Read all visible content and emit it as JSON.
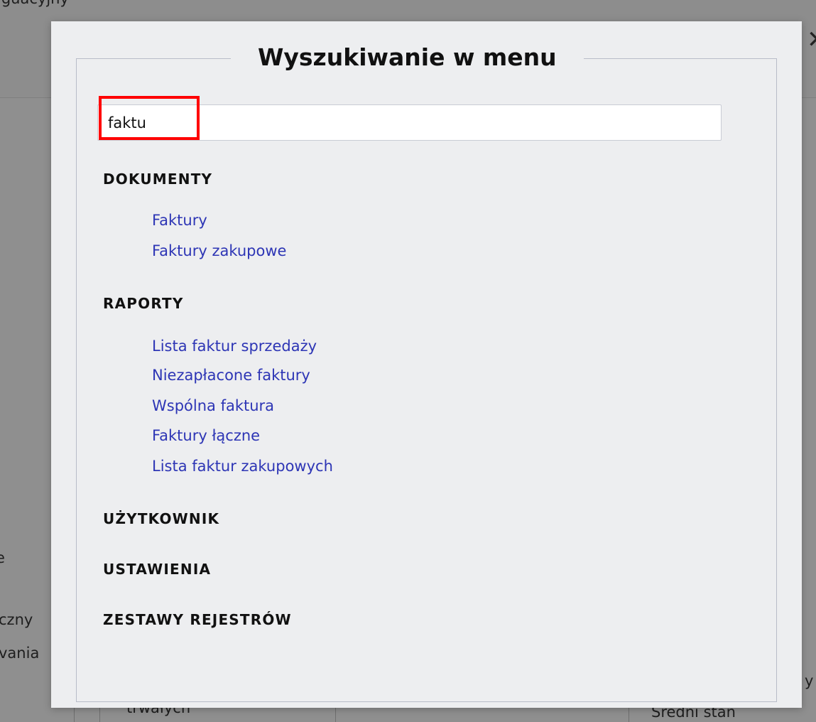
{
  "background": {
    "top_fragment": "iguacyjny",
    "left_fragments": [
      "e",
      "czny",
      "vania"
    ],
    "bottom_fragments": [
      "trwałych",
      "Średni stan"
    ],
    "right_fragment": "y"
  },
  "modal": {
    "title": "Wyszukiwanie w menu",
    "search": {
      "value": "faktu",
      "placeholder": ""
    },
    "sections": [
      {
        "label": "DOKUMENTY",
        "items": [
          "Faktury",
          "Faktury zakupowe"
        ]
      },
      {
        "label": "RAPORTY",
        "items": [
          "Lista faktur sprzedaży",
          "Niezapłacone faktury",
          "Wspólna faktura",
          "Faktury łączne",
          "Lista faktur zakupowych"
        ]
      },
      {
        "label": "UŻYTKOWNIK",
        "items": []
      },
      {
        "label": "USTAWIENIA",
        "items": []
      },
      {
        "label": "ZESTAWY REJESTRÓW",
        "items": []
      }
    ]
  },
  "colors": {
    "link": "#2d35b5",
    "highlight": "#ff0000",
    "modal_bg": "#edeef0",
    "overlay": "#8f8f8f"
  },
  "icons": {
    "close": "close-icon"
  }
}
